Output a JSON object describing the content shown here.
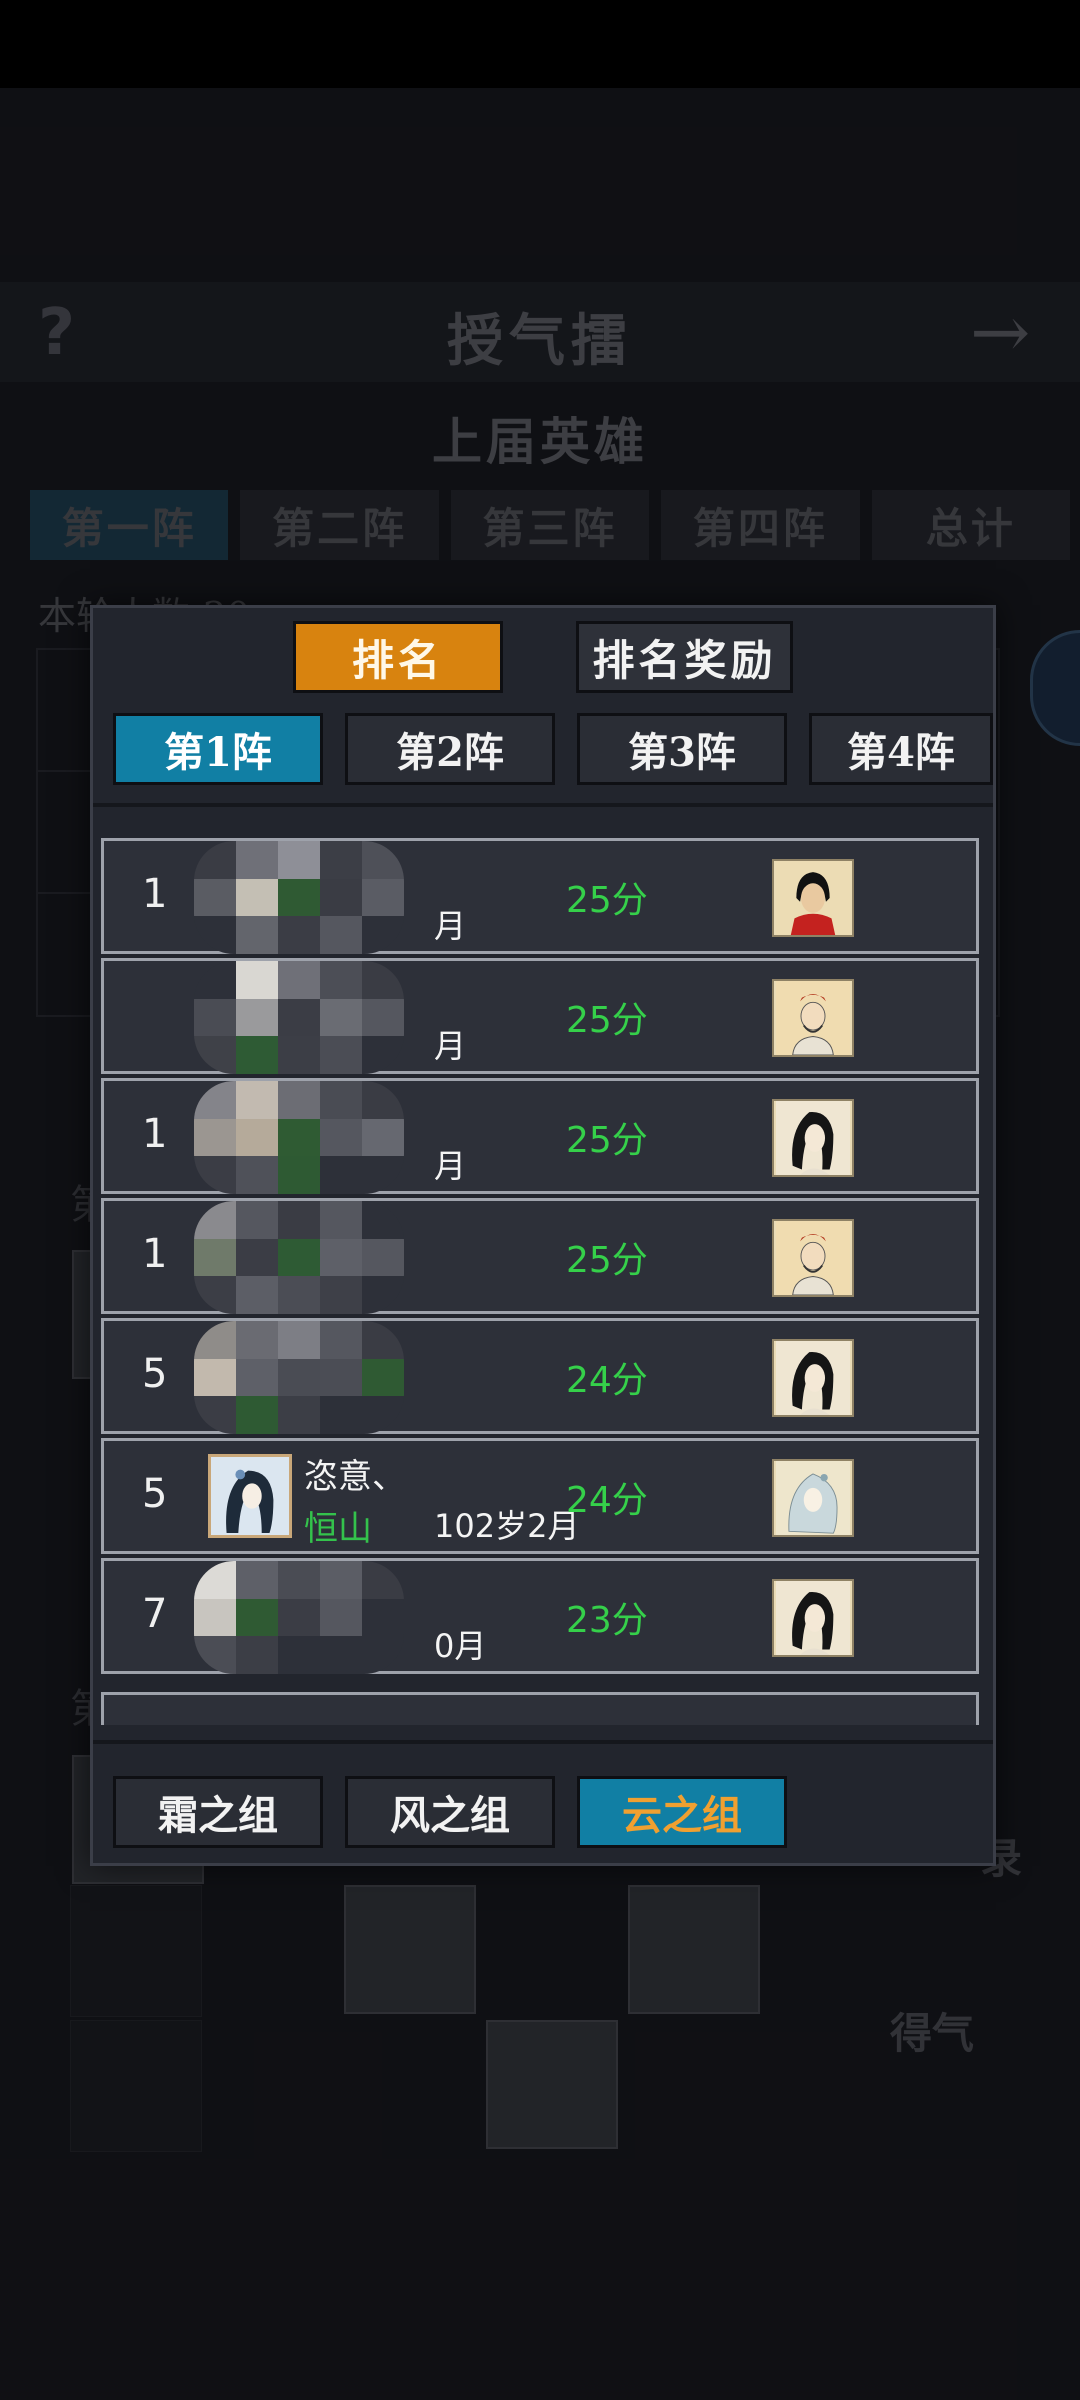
{
  "background": {
    "help_glyph": "?",
    "title": "授气擂",
    "arrow_glyph": "→",
    "subtitle": "上届英雄",
    "tabs": [
      "第一阵",
      "第二阵",
      "第三阵",
      "第四阵",
      "总计"
    ],
    "count_label": "本轮人数 30",
    "side_label_1": "第",
    "side_label_2": "第",
    "record_label": "录",
    "gain_label": "得气"
  },
  "modal": {
    "top_buttons": [
      {
        "label": "排名",
        "active": true
      },
      {
        "label": "排名奖励",
        "active": false
      }
    ],
    "round_tabs": [
      {
        "label": "第1阵",
        "active": true
      },
      {
        "label": "第2阵",
        "active": false
      },
      {
        "label": "第3阵",
        "active": false
      },
      {
        "label": "第4阵",
        "active": false
      }
    ],
    "rows": [
      {
        "rank": "1",
        "name": "",
        "sect": "",
        "age": "月",
        "score": "25分",
        "hero_icon": "red-scarf-hero-icon",
        "censored": true
      },
      {
        "rank": "",
        "name": "",
        "sect": "",
        "age": "月",
        "score": "25分",
        "hero_icon": "bearded-hero-icon",
        "censored": true
      },
      {
        "rank": "1",
        "name": "",
        "sect": "",
        "age": "月",
        "score": "25分",
        "hero_icon": "long-hair-hero-icon",
        "censored": true
      },
      {
        "rank": "1",
        "name": "",
        "sect": "",
        "age": "",
        "score": "25分",
        "hero_icon": "bearded-hero-icon",
        "censored": true
      },
      {
        "rank": "5",
        "name": "",
        "sect": "",
        "age": "",
        "score": "24分",
        "hero_icon": "long-hair-hero-icon",
        "censored": true
      },
      {
        "rank": "5",
        "name": "恣意、",
        "sect": "恒山",
        "age": "102岁2月",
        "score": "24分",
        "hero_icon": "lady-hero-icon",
        "censored": false
      },
      {
        "rank": "7",
        "name": "",
        "sect": "",
        "age": "0月",
        "score": "23分",
        "hero_icon": "long-hair-hero-icon",
        "censored": true
      }
    ],
    "group_tabs": [
      {
        "label": "霜之组",
        "active": false
      },
      {
        "label": "风之组",
        "active": false
      },
      {
        "label": "云之组",
        "active": true
      }
    ]
  },
  "colors": {
    "active_orange": "#d8830f",
    "active_blue": "#117fa4",
    "score_green": "#35d04a",
    "sect_green": "#34c24c",
    "active_group_text": "#f0a030"
  }
}
